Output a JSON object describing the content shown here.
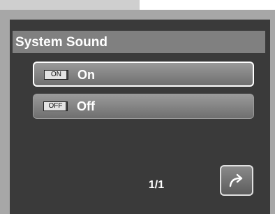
{
  "menu": {
    "title": "System Sound",
    "options": [
      {
        "badge": "ON",
        "label": "On",
        "selected": true
      },
      {
        "badge": "OFF",
        "label": "Off",
        "selected": false
      }
    ]
  },
  "footer": {
    "page_indicator": "1/1",
    "return_icon": "return-arrow-icon"
  },
  "colors": {
    "screen_bg": "#3a3a3a",
    "title_bar": "#808080",
    "frame": "#a7a7a7",
    "selection_border": "#ffffff"
  }
}
